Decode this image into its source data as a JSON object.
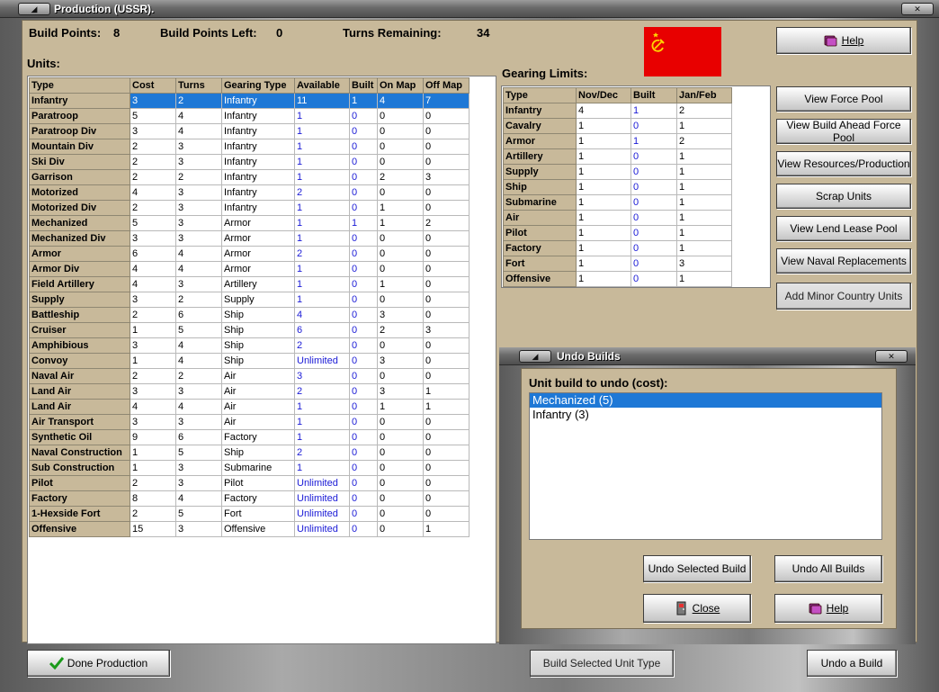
{
  "window": {
    "title": "Production (USSR)."
  },
  "summary": {
    "build_points_label": "Build Points:",
    "build_points": "8",
    "build_points_left_label": "Build Points Left:",
    "build_points_left": "0",
    "turns_remaining_label": "Turns Remaining:",
    "turns_remaining": "34"
  },
  "flag": {
    "colors": {
      "field": "#e80000",
      "emblem": "#ffd400"
    }
  },
  "units": {
    "label": "Units:",
    "columns": [
      "Type",
      "Cost",
      "Turns",
      "Gearing Type",
      "Available",
      "Built",
      "On Map",
      "Off Map"
    ],
    "rows": [
      [
        "Infantry",
        "3",
        "2",
        "Infantry",
        "11",
        "1",
        "4",
        "7"
      ],
      [
        "Paratroop",
        "5",
        "4",
        "Infantry",
        "1",
        "0",
        "0",
        "0"
      ],
      [
        "Paratroop Div",
        "3",
        "4",
        "Infantry",
        "1",
        "0",
        "0",
        "0"
      ],
      [
        "Mountain Div",
        "2",
        "3",
        "Infantry",
        "1",
        "0",
        "0",
        "0"
      ],
      [
        "Ski Div",
        "2",
        "3",
        "Infantry",
        "1",
        "0",
        "0",
        "0"
      ],
      [
        "Garrison",
        "2",
        "2",
        "Infantry",
        "1",
        "0",
        "2",
        "3"
      ],
      [
        "Motorized",
        "4",
        "3",
        "Infantry",
        "2",
        "0",
        "0",
        "0"
      ],
      [
        "Motorized Div",
        "2",
        "3",
        "Infantry",
        "1",
        "0",
        "1",
        "0"
      ],
      [
        "Mechanized",
        "5",
        "3",
        "Armor",
        "1",
        "1",
        "1",
        "2"
      ],
      [
        "Mechanized Div",
        "3",
        "3",
        "Armor",
        "1",
        "0",
        "0",
        "0"
      ],
      [
        "Armor",
        "6",
        "4",
        "Armor",
        "2",
        "0",
        "0",
        "0"
      ],
      [
        "Armor Div",
        "4",
        "4",
        "Armor",
        "1",
        "0",
        "0",
        "0"
      ],
      [
        "Field Artillery",
        "4",
        "3",
        "Artillery",
        "1",
        "0",
        "1",
        "0"
      ],
      [
        "Supply",
        "3",
        "2",
        "Supply",
        "1",
        "0",
        "0",
        "0"
      ],
      [
        "Battleship",
        "2",
        "6",
        "Ship",
        "4",
        "0",
        "3",
        "0"
      ],
      [
        "Cruiser",
        "1",
        "5",
        "Ship",
        "6",
        "0",
        "2",
        "3"
      ],
      [
        "Amphibious",
        "3",
        "4",
        "Ship",
        "2",
        "0",
        "0",
        "0"
      ],
      [
        "Convoy",
        "1",
        "4",
        "Ship",
        "Unlimited",
        "0",
        "3",
        "0"
      ],
      [
        "Naval Air",
        "2",
        "2",
        "Air",
        "3",
        "0",
        "0",
        "0"
      ],
      [
        "Land Air",
        "3",
        "3",
        "Air",
        "2",
        "0",
        "3",
        "1"
      ],
      [
        "Land Air",
        "4",
        "4",
        "Air",
        "1",
        "0",
        "1",
        "1"
      ],
      [
        "Air Transport",
        "3",
        "3",
        "Air",
        "1",
        "0",
        "0",
        "0"
      ],
      [
        "Synthetic Oil",
        "9",
        "6",
        "Factory",
        "1",
        "0",
        "0",
        "0"
      ],
      [
        "Naval Construction",
        "1",
        "5",
        "Ship",
        "2",
        "0",
        "0",
        "0"
      ],
      [
        "Sub Construction",
        "1",
        "3",
        "Submarine",
        "1",
        "0",
        "0",
        "0"
      ],
      [
        "Pilot",
        "2",
        "3",
        "Pilot",
        "Unlimited",
        "0",
        "0",
        "0"
      ],
      [
        "Factory",
        "8",
        "4",
        "Factory",
        "Unlimited",
        "0",
        "0",
        "0"
      ],
      [
        "1-Hexside Fort",
        "2",
        "5",
        "Fort",
        "Unlimited",
        "0",
        "0",
        "0"
      ],
      [
        "Offensive",
        "15",
        "3",
        "Offensive",
        "Unlimited",
        "0",
        "0",
        "1"
      ]
    ]
  },
  "gearing": {
    "label": "Gearing Limits:",
    "columns": [
      "Type",
      "Nov/Dec",
      "Built",
      "Jan/Feb"
    ],
    "rows": [
      [
        "Infantry",
        "4",
        "1",
        "2"
      ],
      [
        "Cavalry",
        "1",
        "0",
        "1"
      ],
      [
        "Armor",
        "1",
        "1",
        "2"
      ],
      [
        "Artillery",
        "1",
        "0",
        "1"
      ],
      [
        "Supply",
        "1",
        "0",
        "1"
      ],
      [
        "Ship",
        "1",
        "0",
        "1"
      ],
      [
        "Submarine",
        "1",
        "0",
        "1"
      ],
      [
        "Air",
        "1",
        "0",
        "1"
      ],
      [
        "Pilot",
        "1",
        "0",
        "1"
      ],
      [
        "Factory",
        "1",
        "0",
        "1"
      ],
      [
        "Fort",
        "1",
        "0",
        "3"
      ],
      [
        "Offensive",
        "1",
        "0",
        "1"
      ]
    ]
  },
  "buttons": {
    "help": "Help",
    "view_force_pool": "View Force Pool",
    "view_build_ahead": "View Build Ahead Force Pool",
    "view_resources": "View Resources/Production",
    "scrap_units": "Scrap Units",
    "view_lend_lease": "View Lend Lease Pool",
    "view_naval_replacements": "View Naval Replacements",
    "add_minor": "Add Minor Country Units",
    "done_production": "Done Production",
    "build_selected": "Build Selected Unit Type",
    "undo_a_build": "Undo a Build"
  },
  "undo": {
    "title": "Undo Builds",
    "label": "Unit build to undo (cost):",
    "items": [
      "Mechanized (5)",
      "Infantry (3)"
    ],
    "undo_selected": "Undo Selected Build",
    "undo_all": "Undo All Builds",
    "close": "Close",
    "help": "Help"
  }
}
